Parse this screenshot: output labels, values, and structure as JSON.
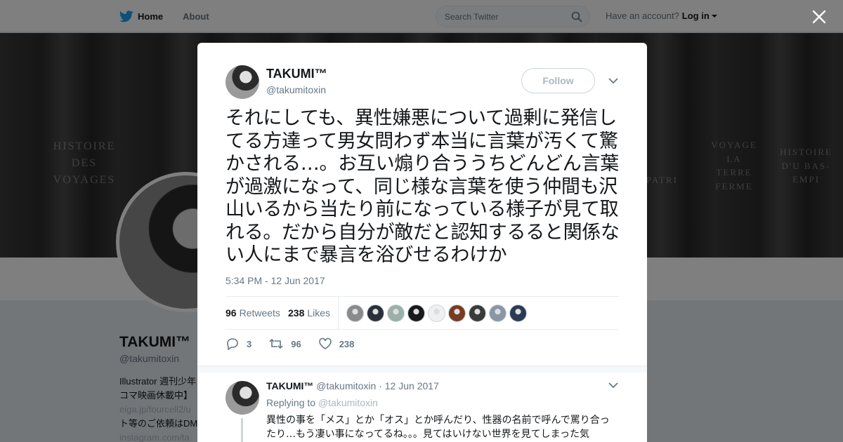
{
  "nav": {
    "home": "Home",
    "about": "About",
    "search_placeholder": "Search Twitter",
    "have_account": "Have an account?",
    "login": "Log in"
  },
  "background_profile": {
    "name": "TAKUMI™",
    "handle": "@takumitoxin",
    "bio_line1": "Illustrator 週刊少年",
    "bio_line2": "コマ映画休載中】",
    "bio_link1": "eiga.jp/fourcell2/u",
    "bio_line3": "ト等のご依頼はDM",
    "bio_link2": "instagram.com/ta",
    "banner_text1": "HISTOIRE DES VOYAGES",
    "banner_text2": "VOYAGE LA TERRE FERME",
    "banner_text3": "PATRI",
    "banner_text4": "HISTOIRE D'U BAS-EMPI"
  },
  "tweet": {
    "name": "TAKUMI™",
    "handle": "@takumitoxin",
    "follow_label": "Follow",
    "text": "それにしても、異性嫌悪について過剰に発信してる方達って男女問わず本当に言葉が汚くて驚かされる…。お互い煽り合ううちどんどん言葉が過激になって、同じ様な言葉を使う仲間も沢山いるから当たり前になっている様子が見て取れる。だから自分が敵だと認知するると関係ない人にまで暴言を浴びせるわけか",
    "timestamp": "5:34 PM - 12 Jun 2017",
    "retweets_count": "96",
    "retweets_label": "Retweets",
    "likes_count": "238",
    "likes_label": "Likes",
    "reply_action_count": "3",
    "retweet_action_count": "96",
    "like_action_count": "238",
    "liker_colors": [
      "#8a8a8a",
      "#2a2f3a",
      "#9ab0a8",
      "#1a1a1a",
      "#f0f0f0",
      "#7a3a22",
      "#3a3a3a",
      "#8a96a6",
      "#2b3a55"
    ]
  },
  "reply": {
    "name": "TAKUMI™",
    "handle": "@takumitoxin",
    "date": "· 12 Jun 2017",
    "replying_to_label": "Replying to",
    "replying_to_handle": "@takumitoxin",
    "text": "異性の事を「メス」とか「オス」とか呼んだり、性器の名前で呼んで罵り合ったり…もう凄い事になってるね。。。見てはいけない世界を見てしまった気"
  }
}
